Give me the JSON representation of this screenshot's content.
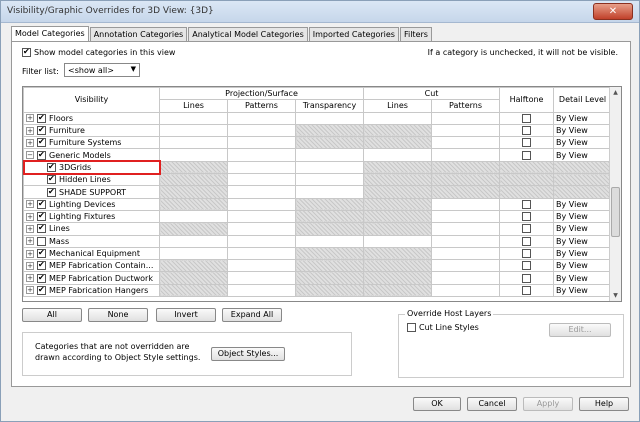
{
  "window": {
    "title": "Visibility/Graphic Overrides for 3D View: {3D}",
    "close_label": "✕"
  },
  "tabs": [
    "Model Categories",
    "Annotation Categories",
    "Analytical Model Categories",
    "Imported Categories",
    "Filters"
  ],
  "active_tab": 0,
  "show_model_categories": {
    "label": "Show model categories in this view",
    "checked": true
  },
  "hint": "If a category is unchecked, it will not be visible.",
  "filter": {
    "label": "Filter list:",
    "value": "<show all>"
  },
  "table": {
    "headers": {
      "visibility": "Visibility",
      "projection_surface": "Projection/Surface",
      "cut": "Cut",
      "halftone": "Halftone",
      "detail_level": "Detail Level",
      "lines": "Lines",
      "patterns": "Patterns",
      "transparency": "Transparency",
      "cut_lines": "Lines",
      "cut_patterns": "Patterns"
    },
    "rows": [
      {
        "name": "Floors",
        "expander": "+",
        "level": 0,
        "checked": true,
        "halftone": true,
        "detail": "By View",
        "hatch": []
      },
      {
        "name": "Furniture",
        "expander": "+",
        "level": 0,
        "checked": true,
        "halftone": true,
        "detail": "By View",
        "hatch": [
          3,
          4
        ]
      },
      {
        "name": "Furniture Systems",
        "expander": "+",
        "level": 0,
        "checked": true,
        "halftone": true,
        "detail": "By View",
        "hatch": [
          3,
          4
        ]
      },
      {
        "name": "Generic Models",
        "expander": "−",
        "level": 0,
        "checked": true,
        "halftone": true,
        "detail": "By View",
        "hatch": []
      },
      {
        "name": "3DGrids",
        "expander": "",
        "level": 1,
        "checked": true,
        "halftone": false,
        "detail": "",
        "hatch": [
          1,
          4,
          5,
          6
        ],
        "highlight": true
      },
      {
        "name": "Hidden Lines",
        "expander": "",
        "level": 1,
        "checked": true,
        "halftone": false,
        "detail": "",
        "hatch": [
          1,
          4,
          5,
          6
        ]
      },
      {
        "name": "SHADE SUPPORT",
        "expander": "",
        "level": 1,
        "checked": true,
        "halftone": false,
        "detail": "",
        "hatch": [
          1,
          4,
          5,
          6
        ]
      },
      {
        "name": "Lighting Devices",
        "expander": "+",
        "level": 0,
        "checked": true,
        "halftone": true,
        "detail": "By View",
        "hatch": [
          1,
          3,
          4
        ]
      },
      {
        "name": "Lighting Fixtures",
        "expander": "+",
        "level": 0,
        "checked": true,
        "halftone": true,
        "detail": "By View",
        "hatch": [
          3,
          4
        ]
      },
      {
        "name": "Lines",
        "expander": "+",
        "level": 0,
        "checked": true,
        "halftone": true,
        "detail": "By View",
        "hatch": [
          1,
          3,
          4
        ]
      },
      {
        "name": "Mass",
        "expander": "+",
        "level": 0,
        "checked": false,
        "halftone": true,
        "detail": "By View",
        "hatch": []
      },
      {
        "name": "Mechanical Equipment",
        "expander": "+",
        "level": 0,
        "checked": true,
        "halftone": true,
        "detail": "By View",
        "hatch": [
          3,
          4
        ]
      },
      {
        "name": "MEP Fabrication Contain...",
        "expander": "+",
        "level": 0,
        "checked": true,
        "halftone": true,
        "detail": "By View",
        "hatch": [
          1,
          3,
          4
        ]
      },
      {
        "name": "MEP Fabrication Ductwork",
        "expander": "+",
        "level": 0,
        "checked": true,
        "halftone": true,
        "detail": "By View",
        "hatch": [
          1,
          3,
          4
        ]
      },
      {
        "name": "MEP Fabrication Hangers",
        "expander": "+",
        "level": 0,
        "checked": true,
        "halftone": true,
        "detail": "By View",
        "hatch": [
          1,
          3,
          4
        ]
      }
    ]
  },
  "buttons": {
    "all": "All",
    "none": "None",
    "invert": "Invert",
    "expand_all": "Expand All",
    "object_styles": "Object Styles...",
    "edit": "Edit...",
    "ok": "OK",
    "cancel": "Cancel",
    "apply": "Apply",
    "help": "Help"
  },
  "note": "Categories that are not overridden are drawn according to Object Style settings.",
  "override_host": {
    "legend": "Override Host Layers",
    "cut_line_styles": "Cut Line Styles",
    "checked": false
  }
}
